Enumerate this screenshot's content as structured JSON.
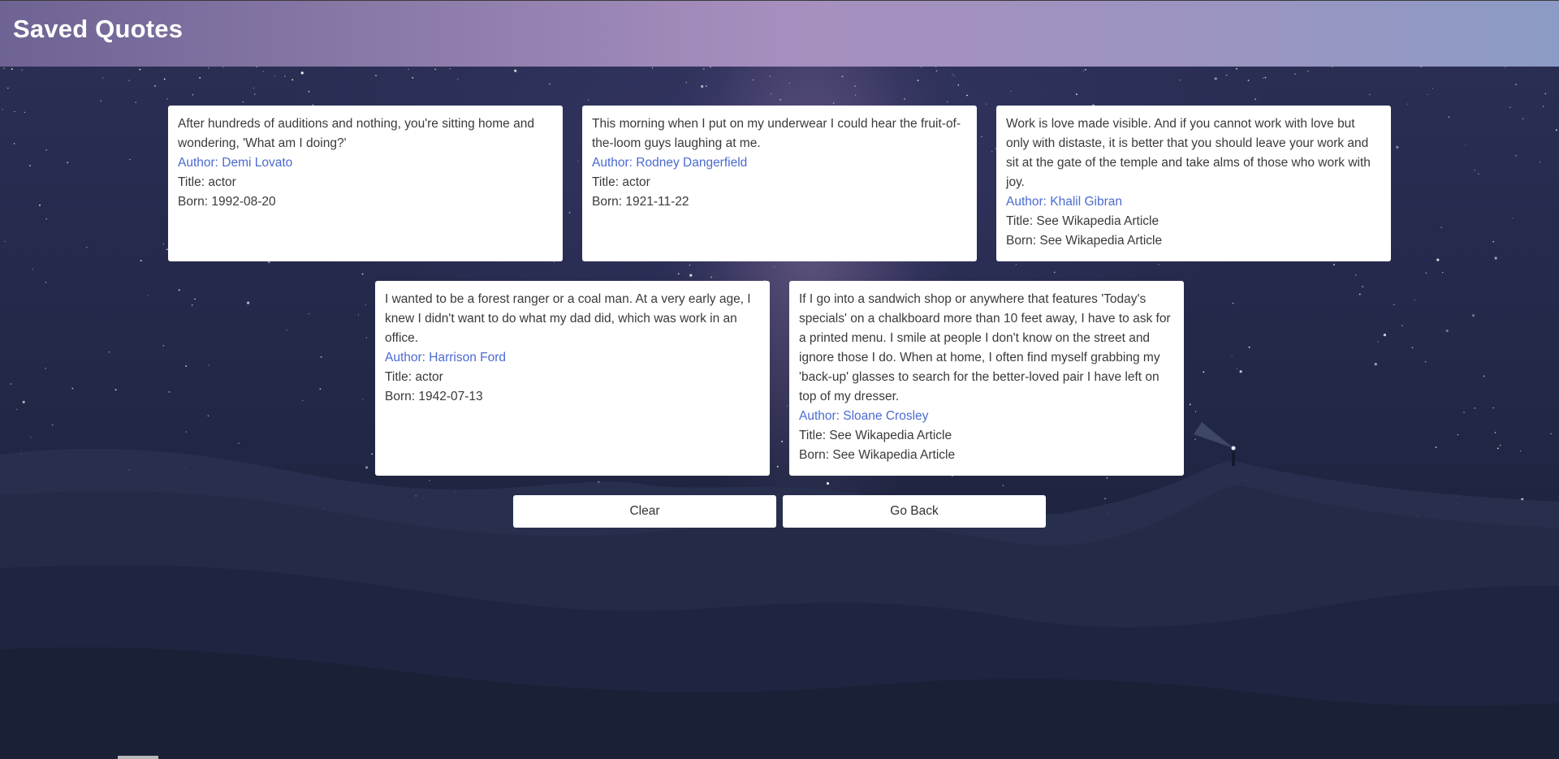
{
  "header": {
    "title": "Saved Quotes"
  },
  "quotes": [
    {
      "text": "After hundreds of auditions and nothing, you're sitting home and wondering, 'What am I doing?'",
      "author": "Author: Demi Lovato",
      "title": "Title: actor",
      "born": "Born: 1992-08-20"
    },
    {
      "text": "This morning when I put on my underwear I could hear the fruit-of-the-loom guys laughing at me.",
      "author": "Author: Rodney Dangerfield",
      "title": "Title: actor",
      "born": "Born: 1921-11-22"
    },
    {
      "text": "Work is love made visible. And if you cannot work with love but only with distaste, it is better that you should leave your work and sit at the gate of the temple and take alms of those who work with joy.",
      "author": "Author: Khalil Gibran",
      "title": "Title: See Wikapedia Article",
      "born": "Born: See Wikapedia Article"
    },
    {
      "text": "I wanted to be a forest ranger or a coal man. At a very early age, I knew I didn't want to do what my dad did, which was work in an office.",
      "author": "Author: Harrison Ford",
      "title": "Title: actor",
      "born": "Born: 1942-07-13"
    },
    {
      "text": "If I go into a sandwich shop or anywhere that features 'Today's specials' on a chalkboard more than 10 feet away, I have to ask for a printed menu. I smile at people I don't know on the street and ignore those I do. When at home, I often find myself grabbing my 'back-up' glasses to search for the better-loved pair I have left on top of my dresser.",
      "author": "Author: Sloane Crosley",
      "title": "Title: See Wikapedia Article",
      "born": "Born: See Wikapedia Article"
    }
  ],
  "buttons": {
    "clear": "Clear",
    "back": "Go Back"
  },
  "colors": {
    "author_link": "#4a6ad0",
    "header_start": "#6f6394",
    "header_mid": "#a68fbe",
    "header_end": "#8b9bc5"
  }
}
